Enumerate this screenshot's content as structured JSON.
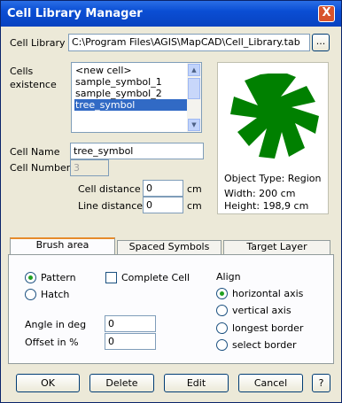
{
  "window": {
    "title": "Cell Library Manager",
    "close_glyph": "X"
  },
  "library": {
    "label": "Cell Library",
    "path": "C:\\Program Files\\AGIS\\MapCAD\\Cell_Library.tab",
    "browse": "..."
  },
  "cells": {
    "label_line1": "Cells",
    "label_line2": "existence",
    "items": [
      "<new cell>",
      "sample_symbol_1",
      "sample_symbol_2",
      "tree_symbol"
    ],
    "selected": "tree_symbol"
  },
  "preview": {
    "object_type": "Object Type: Region",
    "width": "Width: 200  cm",
    "height": "Height: 198,9  cm",
    "fill_color": "#008000"
  },
  "cell_name": {
    "label": "Cell Name",
    "value": "tree_symbol"
  },
  "cell_number": {
    "label": "Cell Number",
    "value": "3"
  },
  "cell_distance": {
    "label": "Cell distance",
    "value": "0",
    "unit": "cm"
  },
  "line_distance": {
    "label": "Line distance",
    "value": "0",
    "unit": "cm"
  },
  "tabs": [
    "Brush area",
    "Spaced Symbols",
    "Target Layer"
  ],
  "brush": {
    "pattern": "Pattern",
    "hatch": "Hatch",
    "complete_cell": "Complete Cell",
    "angle_label": "Angle in deg",
    "angle_value": "0",
    "offset_label": "Offset in %",
    "offset_value": "0",
    "align_label": "Align",
    "align_options": [
      "horizontal axis",
      "vertical axis",
      "longest border",
      "select border"
    ]
  },
  "buttons": {
    "ok": "OK",
    "delete": "Delete",
    "edit": "Edit",
    "cancel": "Cancel",
    "help": "?"
  }
}
